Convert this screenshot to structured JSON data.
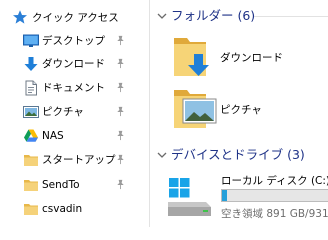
{
  "navigation": {
    "items": [
      {
        "label": "クイック アクセス",
        "icon": "star-icon"
      },
      {
        "label": "デスクトップ",
        "icon": "desktop-icon",
        "pinned": true
      },
      {
        "label": "ダウンロード",
        "icon": "download-arrow-icon",
        "pinned": true
      },
      {
        "label": "ドキュメント",
        "icon": "document-icon",
        "pinned": true
      },
      {
        "label": "ピクチャ",
        "icon": "pictures-icon",
        "pinned": true
      },
      {
        "label": "NAS",
        "icon": "google-drive-icon",
        "pinned": true
      },
      {
        "label": "スタートアップ",
        "icon": "folder-icon",
        "pinned": true
      },
      {
        "label": "SendTo",
        "icon": "folder-icon",
        "pinned": true
      },
      {
        "label": "csvadin",
        "icon": "folder-icon",
        "pinned": false
      }
    ]
  },
  "content": {
    "folders_group": {
      "title": "フォルダー (6)"
    },
    "folders": [
      {
        "label": "ダウンロード",
        "icon": "downloads-folder-icon"
      },
      {
        "label": "ピクチャ",
        "icon": "pictures-folder-icon"
      }
    ],
    "devices_group": {
      "title": "デバイスとドライブ (3)"
    },
    "drive": {
      "name": "ローカル ディスク (C:)",
      "space_text": "空き領域 891 GB/931",
      "used_fraction": 0.043,
      "icon": "windows-drive-icon"
    }
  },
  "colors": {
    "accent_blue": "#1e3287",
    "folder_yellow": "#f0c657",
    "download_blue": "#1f7fd8",
    "drive_bar": "#26a0da"
  }
}
